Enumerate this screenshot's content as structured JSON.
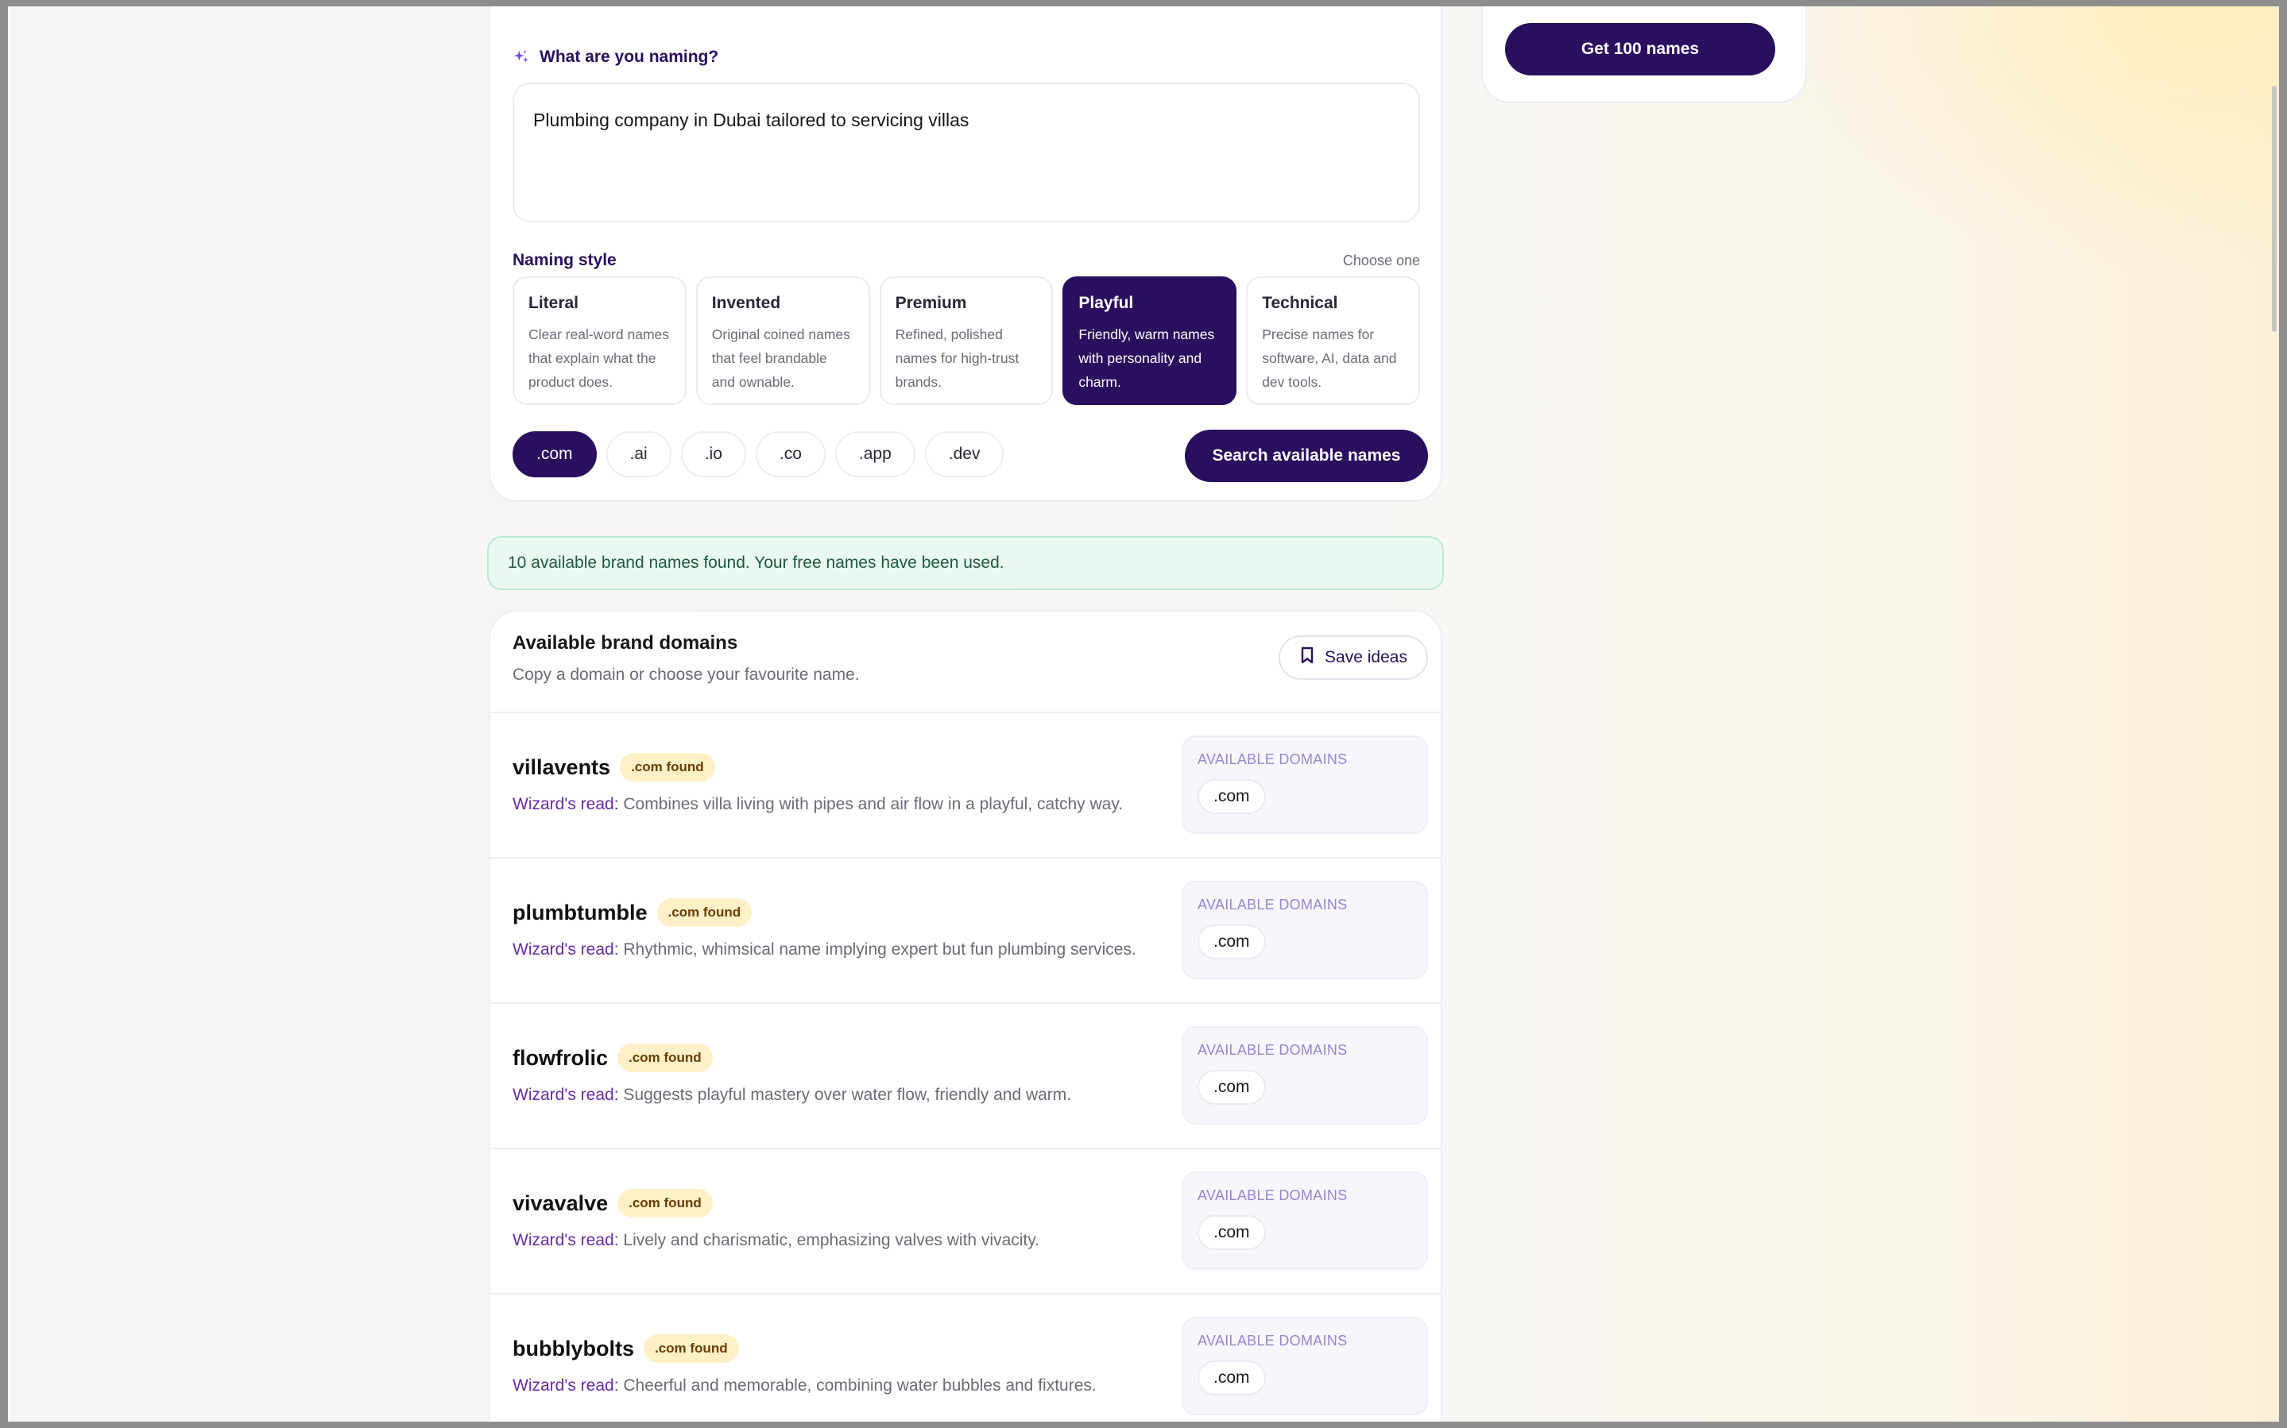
{
  "sidebar": {
    "get_button": "Get 100 names"
  },
  "form": {
    "question": "What are you naming?",
    "description": "Plumbing company in Dubai tailored to servicing villas",
    "naming_style_title": "Naming style",
    "naming_style_hint": "Choose one",
    "styles": [
      {
        "title": "Literal",
        "desc": "Clear real-word names that explain what the product does.",
        "selected": false
      },
      {
        "title": "Invented",
        "desc": "Original coined names that feel brandable and ownable.",
        "selected": false
      },
      {
        "title": "Premium",
        "desc": "Refined, polished names for high-trust brands.",
        "selected": false
      },
      {
        "title": "Playful",
        "desc": "Friendly, warm names with personality and charm.",
        "selected": true
      },
      {
        "title": "Technical",
        "desc": "Precise names for software, AI, data and dev tools.",
        "selected": false
      }
    ],
    "tlds": [
      {
        "label": ".com",
        "selected": true
      },
      {
        "label": ".ai",
        "selected": false
      },
      {
        "label": ".io",
        "selected": false
      },
      {
        "label": ".co",
        "selected": false
      },
      {
        "label": ".app",
        "selected": false
      },
      {
        "label": ".dev",
        "selected": false
      }
    ],
    "search_button": "Search available names"
  },
  "notice": "10 available brand names found. Your free names have been used.",
  "results": {
    "title": "Available brand domains",
    "subtitle": "Copy a domain or choose your favourite name.",
    "save_button": "Save ideas",
    "items": [
      {
        "name": "villavents",
        "badge": ".com found",
        "read_label": "Wizard's read:",
        "read": "Combines villa living with pipes and air flow in a playful, catchy way.",
        "domains_label": "AVAILABLE DOMAINS",
        "domain": ".com"
      },
      {
        "name": "plumbtumble",
        "badge": ".com found",
        "read_label": "Wizard's read:",
        "read": "Rhythmic, whimsical name implying expert but fun plumbing services.",
        "domains_label": "AVAILABLE DOMAINS",
        "domain": ".com"
      },
      {
        "name": "flowfrolic",
        "badge": ".com found",
        "read_label": "Wizard's read:",
        "read": "Suggests playful mastery over water flow, friendly and warm.",
        "domains_label": "AVAILABLE DOMAINS",
        "domain": ".com"
      },
      {
        "name": "vivavalve",
        "badge": ".com found",
        "read_label": "Wizard's read:",
        "read": "Lively and charismatic, emphasizing valves with vivacity.",
        "domains_label": "AVAILABLE DOMAINS",
        "domain": ".com"
      },
      {
        "name": "bubblybolts",
        "badge": ".com found",
        "read_label": "Wizard's read:",
        "read": "Cheerful and memorable, combining water bubbles and fixtures.",
        "domains_label": "AVAILABLE DOMAINS",
        "domain": ".com"
      }
    ]
  },
  "colors": {
    "brand": "#2a0f5e",
    "accent_text": "#6a2aa8",
    "badge_bg": "#fff0c8",
    "notice_bg": "#e9f8f1"
  }
}
